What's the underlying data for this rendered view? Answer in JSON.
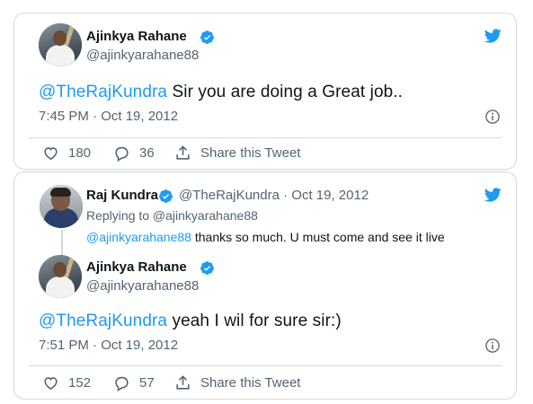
{
  "tweet1": {
    "author_name": "Ajinkya Rahane",
    "handle": "@ajinkyarahane88",
    "mention": "@TheRajKundra",
    "text": " Sir you are doing a Great job..",
    "timestamp": "7:45 PM · Oct 19, 2012",
    "likes": "180",
    "replies": "36",
    "share_label": "Share this Tweet"
  },
  "tweet2": {
    "parent": {
      "author_name": "Raj Kundra",
      "handle_date": "@TheRajKundra · Oct 19, 2012",
      "replying_to": "Replying to @ajinkyarahane88",
      "mention": "@ajinkyarahane88",
      "text": " thanks so much. U must come and see it live"
    },
    "reply": {
      "author_name": "Ajinkya Rahane",
      "handle": "@ajinkyarahane88",
      "mention": "@TheRajKundra",
      "text": " yeah I wil for sure sir:)",
      "timestamp": "7:51 PM · Oct 19, 2012",
      "likes": "152",
      "replies": "57",
      "share_label": "Share this Tweet"
    }
  },
  "colors": {
    "accent": "#1d9bf0",
    "text": "#0f1419",
    "muted": "#536471",
    "border": "#cfd9de"
  },
  "icons": [
    "twitter-bird-icon",
    "verified-badge-icon",
    "info-icon",
    "heart-icon",
    "reply-bubble-icon",
    "share-icon"
  ]
}
